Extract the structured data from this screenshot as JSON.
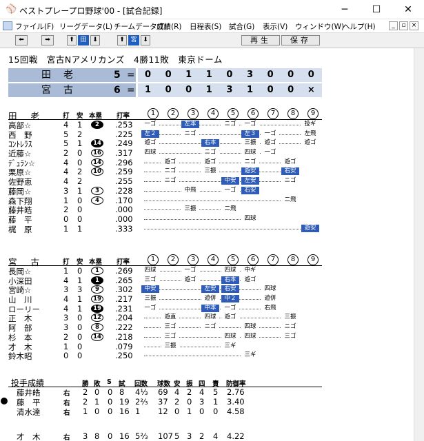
{
  "window": {
    "title": "ベストプレープロ野球'00 - [試合記録]",
    "controls": [
      "─",
      "☐",
      "✕"
    ]
  },
  "menubar": {
    "items": [
      "ファイル(F)",
      "リーグデータ(L)",
      "チームデータ(T)",
      "成績(R)",
      "日程表(S)",
      "試合(G)",
      "表示(V)",
      "ウィンドウ(W)",
      "ヘルプ(H)"
    ],
    "mdi_controls": [
      "_",
      "▫",
      "×"
    ]
  },
  "toolbar": {
    "left_arrow": "⬅",
    "right_arrow": "➡",
    "up1": "⬆",
    "field_label": "田",
    "down1": "⬇",
    "up2": "⬆",
    "team_label": "宮",
    "down2": "⬇",
    "replay": "再生",
    "save": "保存"
  },
  "headline": "15回戦　宮古Nアメリカンズ　4勝11敗　東京ドーム",
  "scoreboard": [
    {
      "team": "田老",
      "score": "5",
      "eq": "=",
      "innings": [
        "0",
        "0",
        "1",
        "1",
        "0",
        "3",
        "0",
        "0",
        "0"
      ]
    },
    {
      "team": "宮古",
      "score": "6",
      "eq": "=",
      "innings": [
        "1",
        "0",
        "0",
        "1",
        "3",
        "1",
        "0",
        "0",
        "×"
      ]
    }
  ],
  "headers": {
    "at_bats": "打",
    "hits": "安",
    "homers": "本塁",
    "average": "打率",
    "innings": [
      "1",
      "2",
      "3",
      "4",
      "5",
      "6",
      "7",
      "8",
      "9"
    ]
  },
  "away": {
    "team": "田老",
    "players": [
      {
        "name": "高部☆",
        "ab": "4",
        "h": "1",
        "hr": "2",
        "hr_fill": true,
        "avg": ".253",
        "plays": [
          {
            "i": 1,
            "t": "一ゴ"
          },
          {
            "i": 3,
            "t": "左本",
            "hit": true
          },
          {
            "i": 5,
            "t": "ニゴ"
          },
          {
            "i": 6,
            "t": "一ゴ"
          },
          {
            "i": 9,
            "t": "投ギ"
          }
        ]
      },
      {
        "name": "西　野",
        "ab": "5",
        "h": "2",
        "hr": "",
        "avg": ".225",
        "plays": [
          {
            "i": 1,
            "t": "左２",
            "hit": true
          },
          {
            "i": 3,
            "t": "ニゴ"
          },
          {
            "i": 6,
            "t": "左３",
            "hit": true
          },
          {
            "i": 7,
            "t": "一ゴ"
          },
          {
            "i": 9,
            "t": "左飛"
          }
        ]
      },
      {
        "name": "ｺﾝﾄﾚﾗｽ",
        "ab": "5",
        "h": "1",
        "hr": "14",
        "hr_fill": true,
        "avg": ".249",
        "plays": [
          {
            "i": 1,
            "t": "遊ゴ"
          },
          {
            "i": 4,
            "t": "右本",
            "hit": true
          },
          {
            "i": 6,
            "t": "三振"
          },
          {
            "i": 7,
            "t": "遊ゴ"
          },
          {
            "i": 9,
            "t": "遊ゴ"
          }
        ]
      },
      {
        "name": "近藤☆",
        "ab": "2",
        "h": "0",
        "hr": "16",
        "avg": ".317",
        "plays": [
          {
            "i": 1,
            "t": "四球"
          },
          {
            "i": 4,
            "t": "ニゴ"
          },
          {
            "i": 6,
            "t": "四球"
          },
          {
            "i": 7,
            "t": "一ゴ"
          }
        ]
      },
      {
        "name": "ﾃﾞｭﾗﾝ☆",
        "ab": "4",
        "h": "0",
        "hr": "14",
        "avg": ".296",
        "plays": [
          {
            "i": 2,
            "t": "遊ゴ"
          },
          {
            "i": 4,
            "t": "遊ゴ"
          },
          {
            "i": 6,
            "t": "ニゴ"
          },
          {
            "i": 8,
            "t": "遊ゴ"
          }
        ]
      },
      {
        "name": "栗原☆",
        "ab": "4",
        "h": "2",
        "hr": "10",
        "avg": ".259",
        "plays": [
          {
            "i": 2,
            "t": "ニゴ"
          },
          {
            "i": 4,
            "t": "三振"
          },
          {
            "i": 6,
            "t": "遊安",
            "hit": true
          },
          {
            "i": 8,
            "t": "右安",
            "hit": true
          }
        ]
      },
      {
        "name": "佐野恵",
        "ab": "4",
        "h": "2",
        "hr": "",
        "avg": ".255",
        "plays": [
          {
            "i": 2,
            "t": "ニゴ"
          },
          {
            "i": 5,
            "t": "中安",
            "hit": true
          },
          {
            "i": 6,
            "t": "左安",
            "hit": true
          },
          {
            "i": 8,
            "t": "ニゴ"
          }
        ]
      },
      {
        "name": "藤岡☆",
        "ab": "3",
        "h": "1",
        "hr": "3",
        "avg": ".228",
        "plays": [
          {
            "i": 3,
            "t": "中飛"
          },
          {
            "i": 5,
            "t": "一ゴ"
          },
          {
            "i": 6,
            "t": "右安",
            "hit": true
          }
        ]
      },
      {
        "name": "森下翔",
        "ab": "1",
        "h": "0",
        "hr": "4",
        "avg": ".170",
        "plays": [
          {
            "i": 8,
            "t": "二飛"
          }
        ]
      },
      {
        "name": "藤井皓",
        "ab": "2",
        "h": "0",
        "hr": "",
        "avg": ".000",
        "plays": [
          {
            "i": 3,
            "t": "三振"
          },
          {
            "i": 5,
            "t": "二飛"
          }
        ]
      },
      {
        "name": "藤　平",
        "ab": "0",
        "h": "0",
        "hr": "",
        "avg": ".000",
        "plays": [
          {
            "i": 6,
            "t": "四球"
          }
        ]
      },
      {
        "name": "梶　原",
        "ab": "1",
        "h": "1",
        "hr": "",
        "avg": ".333",
        "plays": [
          {
            "i": 9,
            "t": "遊安",
            "hit": true
          }
        ]
      }
    ]
  },
  "home": {
    "team": "宮古",
    "players": [
      {
        "name": "長岡☆",
        "ab": "1",
        "h": "0",
        "hr": "1",
        "avg": ".269",
        "plays": [
          {
            "i": 1,
            "t": "四球"
          },
          {
            "i": 3,
            "t": "一ゴ"
          },
          {
            "i": 5,
            "t": "四球"
          },
          {
            "i": 6,
            "t": "中ギ"
          }
        ]
      },
      {
        "name": "小深田",
        "ab": "4",
        "h": "1",
        "hr": "1",
        "hr_fill": true,
        "avg": ".265",
        "plays": [
          {
            "i": 1,
            "t": "三ゴ"
          },
          {
            "i": 3,
            "t": "遊ゴ"
          },
          {
            "i": 5,
            "t": "右本",
            "hit": true
          },
          {
            "i": 6,
            "t": "遊ゴ"
          }
        ]
      },
      {
        "name": "宮崎☆",
        "ab": "3",
        "h": "3",
        "hr": "9",
        "avg": ".302",
        "plays": [
          {
            "i": 1,
            "t": "中安",
            "hit": true
          },
          {
            "i": 4,
            "t": "左安",
            "hit": true
          },
          {
            "i": 5,
            "t": "右安",
            "hit": true
          },
          {
            "i": 7,
            "t": "四球"
          }
        ]
      },
      {
        "name": "山　川",
        "ab": "4",
        "h": "1",
        "hr": "19",
        "avg": ".217",
        "plays": [
          {
            "i": 1,
            "t": "三振"
          },
          {
            "i": 4,
            "t": "遊併"
          },
          {
            "i": 5,
            "t": "中２",
            "hit": true
          },
          {
            "i": 7,
            "t": "遊併"
          }
        ]
      },
      {
        "name": "ローリー",
        "ab": "4",
        "h": "1",
        "hr": "19",
        "hr_fill": true,
        "avg": ".231",
        "plays": [
          {
            "i": 1,
            "t": "一ゴ"
          },
          {
            "i": 4,
            "t": "中本",
            "hit": true
          },
          {
            "i": 5,
            "t": "一ゴ"
          },
          {
            "i": 7,
            "t": "右飛"
          }
        ]
      },
      {
        "name": "正　木",
        "ab": "3",
        "h": "0",
        "hr": "12",
        "avg": ".204",
        "plays": [
          {
            "i": 2,
            "t": "遊直"
          },
          {
            "i": 4,
            "t": "四球"
          },
          {
            "i": 5,
            "t": "遊ゴ"
          },
          {
            "i": 8,
            "t": "三振"
          }
        ]
      },
      {
        "name": "阿　部",
        "ab": "3",
        "h": "0",
        "hr": "8",
        "avg": ".222",
        "plays": [
          {
            "i": 2,
            "t": "三ゴ"
          },
          {
            "i": 4,
            "t": "ニゴ"
          },
          {
            "i": 6,
            "t": "四球"
          },
          {
            "i": 8,
            "t": "ニゴ"
          }
        ]
      },
      {
        "name": "杉　本",
        "ab": "2",
        "h": "0",
        "hr": "14",
        "avg": ".218",
        "plays": [
          {
            "i": 2,
            "t": "三ゴ"
          },
          {
            "i": 5,
            "t": "四球"
          },
          {
            "i": 6,
            "t": "四球"
          },
          {
            "i": 8,
            "t": "三ゴ"
          }
        ]
      },
      {
        "name": "才　木",
        "ab": "1",
        "h": "0",
        "hr": "",
        "avg": ".079",
        "plays": [
          {
            "i": 2,
            "t": "三振"
          },
          {
            "i": 5,
            "t": "三ギ"
          }
        ]
      },
      {
        "name": "鈴木昭",
        "ab": "0",
        "h": "0",
        "hr": "",
        "avg": ".250",
        "plays": [
          {
            "i": 6,
            "t": "三ギ"
          }
        ]
      }
    ]
  },
  "pitching": {
    "title": "投手成績",
    "headers": [
      "勝",
      "敗",
      "S",
      "試",
      "回数",
      "球数",
      "安",
      "振",
      "四",
      "責",
      "防御率"
    ],
    "rows": [
      {
        "name": "藤井皓",
        "hand": "右",
        "w": "2",
        "l": "0",
        "s": "0",
        "g": "8",
        "ip": "4⅓",
        "np": "69",
        "h": "4",
        "so": "2",
        "bb": "4",
        "er": "5",
        "era": "2.76",
        "marker": false
      },
      {
        "name": "藤　平",
        "hand": "右",
        "w": "2",
        "l": "1",
        "s": "0",
        "g": "19",
        "ip": "2⅔",
        "np": "37",
        "h": "2",
        "so": "0",
        "bb": "3",
        "er": "1",
        "era": "3.40",
        "marker": true
      },
      {
        "name": "清水達",
        "hand": "右",
        "w": "1",
        "l": "0",
        "s": "0",
        "g": "16",
        "ip": "1",
        "np": "12",
        "h": "0",
        "so": "1",
        "bb": "0",
        "er": "0",
        "era": "4.58",
        "marker": false
      },
      {
        "name": "才　木",
        "hand": "右",
        "w": "3",
        "l": "8",
        "s": "0",
        "g": "16",
        "ip": "5⅔",
        "np": "107",
        "h": "5",
        "so": "3",
        "bb": "2",
        "er": "4",
        "era": "4.22",
        "marker": false
      }
    ]
  }
}
